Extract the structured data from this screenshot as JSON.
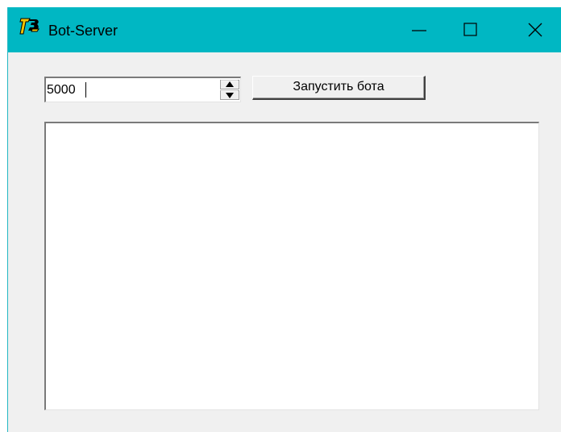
{
  "window": {
    "title": "Bot-Server",
    "icon": "delphi-app-icon",
    "titlebar_color": "#00b7c3",
    "controls": {
      "minimize_icon": "minimize-icon",
      "maximize_icon": "maximize-icon",
      "close_icon": "close-icon"
    }
  },
  "form": {
    "port_spin": {
      "value": "5000",
      "up_icon": "arrow-up-icon",
      "down_icon": "arrow-down-icon"
    },
    "run_button_label": "Запустить бота",
    "log_memo_text": ""
  }
}
